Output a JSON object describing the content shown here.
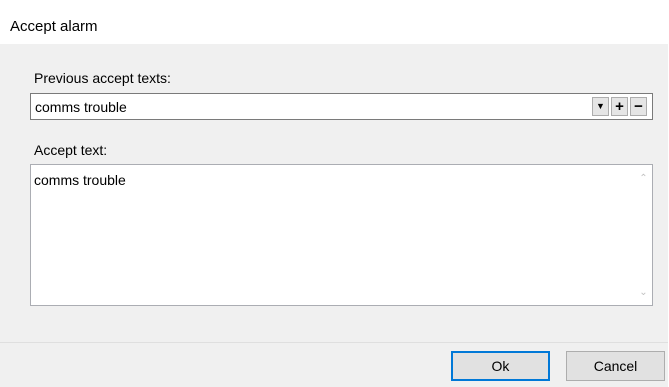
{
  "window": {
    "title": "Accept alarm"
  },
  "previous": {
    "label": "Previous accept texts:",
    "selected_value": "comms trouble",
    "buttons": {
      "dropdown_icon": "chevron-down-icon",
      "add_icon": "plus-icon",
      "remove_icon": "minus-icon",
      "dropdown_glyph": "▼",
      "add_glyph": "+",
      "remove_glyph": "−"
    }
  },
  "accept": {
    "label": "Accept text:",
    "value": "comms trouble",
    "scroll_up_glyph": "⌃",
    "scroll_down_glyph": "⌄"
  },
  "footer": {
    "ok_label": "Ok",
    "cancel_label": "Cancel"
  },
  "colors": {
    "accent": "#0078d7",
    "dialog_background": "#f0f0f0",
    "window_border": "#f0c36a"
  }
}
